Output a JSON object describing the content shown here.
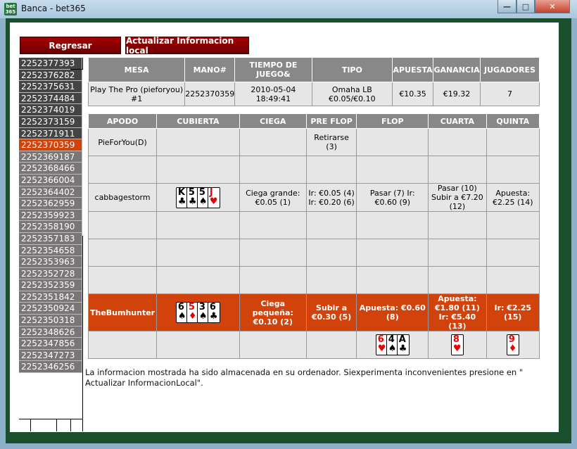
{
  "window": {
    "title": "Banca - bet365",
    "app_icon_text": "bet 365"
  },
  "buttons": {
    "back": "Regresar",
    "update": "Actualizar Informacion local"
  },
  "hands": [
    {
      "id": "2252377393",
      "state": "dark"
    },
    {
      "id": "2252376282",
      "state": "dark"
    },
    {
      "id": "2252375631",
      "state": "dark"
    },
    {
      "id": "2252374484",
      "state": "dark"
    },
    {
      "id": "2252374019",
      "state": "dark"
    },
    {
      "id": "2252373159",
      "state": "dark"
    },
    {
      "id": "2252371911",
      "state": "dark"
    },
    {
      "id": "2252370359",
      "state": "sel"
    },
    {
      "id": "2252369187",
      "state": "gray"
    },
    {
      "id": "2252368466",
      "state": "gray"
    },
    {
      "id": "2252366004",
      "state": "gray"
    },
    {
      "id": "2252364402",
      "state": "gray"
    },
    {
      "id": "2252362959",
      "state": "gray"
    },
    {
      "id": "2252359923",
      "state": "gray"
    },
    {
      "id": "2252358190",
      "state": "gray"
    },
    {
      "id": "2252357183",
      "state": "gray"
    },
    {
      "id": "2252354658",
      "state": "gray"
    },
    {
      "id": "2252353963",
      "state": "gray"
    },
    {
      "id": "2252352728",
      "state": "gray"
    },
    {
      "id": "2252352359",
      "state": "gray"
    },
    {
      "id": "2252351842",
      "state": "gray"
    },
    {
      "id": "2252350924",
      "state": "gray"
    },
    {
      "id": "2252350318",
      "state": "gray"
    },
    {
      "id": "2252348626",
      "state": "gray"
    },
    {
      "id": "2252347856",
      "state": "gray"
    },
    {
      "id": "2252347273",
      "state": "gray"
    },
    {
      "id": "2252346256",
      "state": "gray"
    }
  ],
  "info": {
    "headers": [
      "MESA",
      "MANO#",
      "TIEMPO DE JUEGO&",
      "TIPO",
      "APUESTA",
      "GANANCIA",
      "JUGADORES"
    ],
    "row": [
      "Play The Pro (pieforyou) #1",
      "2252370359",
      "2010-05-04 18:49:41",
      "Omaha LB €0.05/€0.10",
      "€10.35",
      "€19.32",
      "7"
    ]
  },
  "game": {
    "headers": [
      "APODO",
      "CUBIERTA",
      "CIEGA",
      "PRE FLOP",
      "FLOP",
      "CUARTA",
      "QUINTA"
    ],
    "rows": [
      {
        "apodo": "PieForYou(D)",
        "ciega": "",
        "preflop": "Retirarse (3)",
        "flop": "",
        "cuarta": "",
        "quinta": ""
      },
      {
        "apodo": "",
        "ciega": "",
        "preflop": "",
        "flop": "",
        "cuarta": "",
        "quinta": ""
      },
      {
        "apodo": "cabbagestorm",
        "ciega": "Ciega grande: €0.05 (1)",
        "preflop": "Ir: €0.05 (4) Ir: €0.20 (6)",
        "flop": "Pasar (7) Ir: €0.60 (9)",
        "cuarta": "Pasar (10) Subir a €7.20 (12)",
        "quinta": "Apuesta: €2.25 (14)"
      },
      {
        "apodo": "",
        "ciega": "",
        "preflop": "",
        "flop": "",
        "cuarta": "",
        "quinta": ""
      },
      {
        "apodo": "",
        "ciega": "",
        "preflop": "",
        "flop": "",
        "cuarta": "",
        "quinta": ""
      },
      {
        "apodo": "",
        "ciega": "",
        "preflop": "",
        "flop": "",
        "cuarta": "",
        "quinta": ""
      },
      {
        "apodo": "TheBumhunter",
        "ciega": "Ciega pequeña: €0.10 (2)",
        "preflop": "Subir a €0.30 (5)",
        "flop": "Apuesta: €0.60 (8)",
        "cuarta": "Apuesta: €1.80 (11) Ir: €5.40 (13)",
        "quinta": "Ir: €2.25 (15)"
      }
    ],
    "cabbage_cards": [
      {
        "rank": "K",
        "suit": "♣",
        "color": "blk"
      },
      {
        "rank": "5",
        "suit": "♣",
        "color": "blk"
      },
      {
        "rank": "5",
        "suit": "♠",
        "color": "blk"
      },
      {
        "rank": "J",
        "suit": "♥",
        "color": "red"
      }
    ],
    "hero_cards": [
      {
        "rank": "6",
        "suit": "♠",
        "color": "blk"
      },
      {
        "rank": "5",
        "suit": "♦",
        "color": "red"
      },
      {
        "rank": "3",
        "suit": "♠",
        "color": "blk"
      },
      {
        "rank": "6",
        "suit": "♣",
        "color": "blk"
      }
    ],
    "board_flop": [
      {
        "rank": "6",
        "suit": "♥",
        "color": "red"
      },
      {
        "rank": "4",
        "suit": "♠",
        "color": "blk"
      },
      {
        "rank": "A",
        "suit": "♣",
        "color": "blk"
      }
    ],
    "board_turn": [
      {
        "rank": "8",
        "suit": "♥",
        "color": "red"
      }
    ],
    "board_river": [
      {
        "rank": "9",
        "suit": "♦",
        "color": "red"
      }
    ]
  },
  "note": "La informacion mostrada ha sido almacenada en su ordenador. Siexperimenta inconvenientes presione en \" Actualizar InformacionLocal\"."
}
